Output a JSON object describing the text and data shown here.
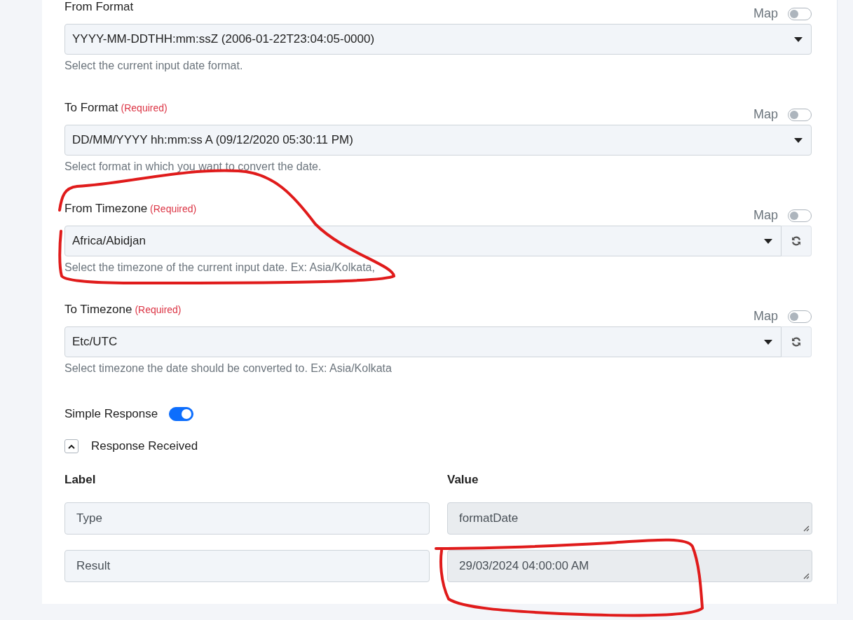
{
  "fields": [
    {
      "label": "From Format",
      "map": {
        "label": "Map",
        "on": false
      },
      "select": {
        "value": "YYYY-MM-DDTHH:mm:ssZ (2006-01-22T23:04:05-0000)"
      },
      "refresh": false,
      "help": "Select the current input date format."
    },
    {
      "label": "To Format",
      "required": "(Required)",
      "map": {
        "label": "Map",
        "on": false
      },
      "select": {
        "value": "DD/MM/YYYY hh:mm:ss A (09/12/2020 05:30:11 PM)"
      },
      "refresh": false,
      "help": "Select format in which you want to convert the date."
    },
    {
      "label": "From Timezone",
      "required": "(Required)",
      "map": {
        "label": "Map",
        "on": false
      },
      "select": {
        "value": "Africa/Abidjan"
      },
      "refresh": true,
      "help": "Select the timezone of the current input date. Ex: Asia/Kolkata,"
    },
    {
      "label": "To Timezone",
      "required": "(Required)",
      "map": {
        "label": "Map",
        "on": false
      },
      "select": {
        "value": "Etc/UTC"
      },
      "refresh": true,
      "help": "Select timezone the date should be converted to. Ex: Asia/Kolkata"
    }
  ],
  "simple_response": {
    "label": "Simple Response",
    "on": true
  },
  "response": {
    "title": "Response Received",
    "expanded": true,
    "columns": [
      "Label",
      "Value"
    ],
    "rows": [
      {
        "label": "Type",
        "value": "formatDate"
      },
      {
        "label": "Result",
        "value": "29/03/2024 04:00:00 AM"
      }
    ]
  },
  "annotations": [
    {
      "kind": "loop"
    },
    {
      "kind": "loop"
    }
  ]
}
